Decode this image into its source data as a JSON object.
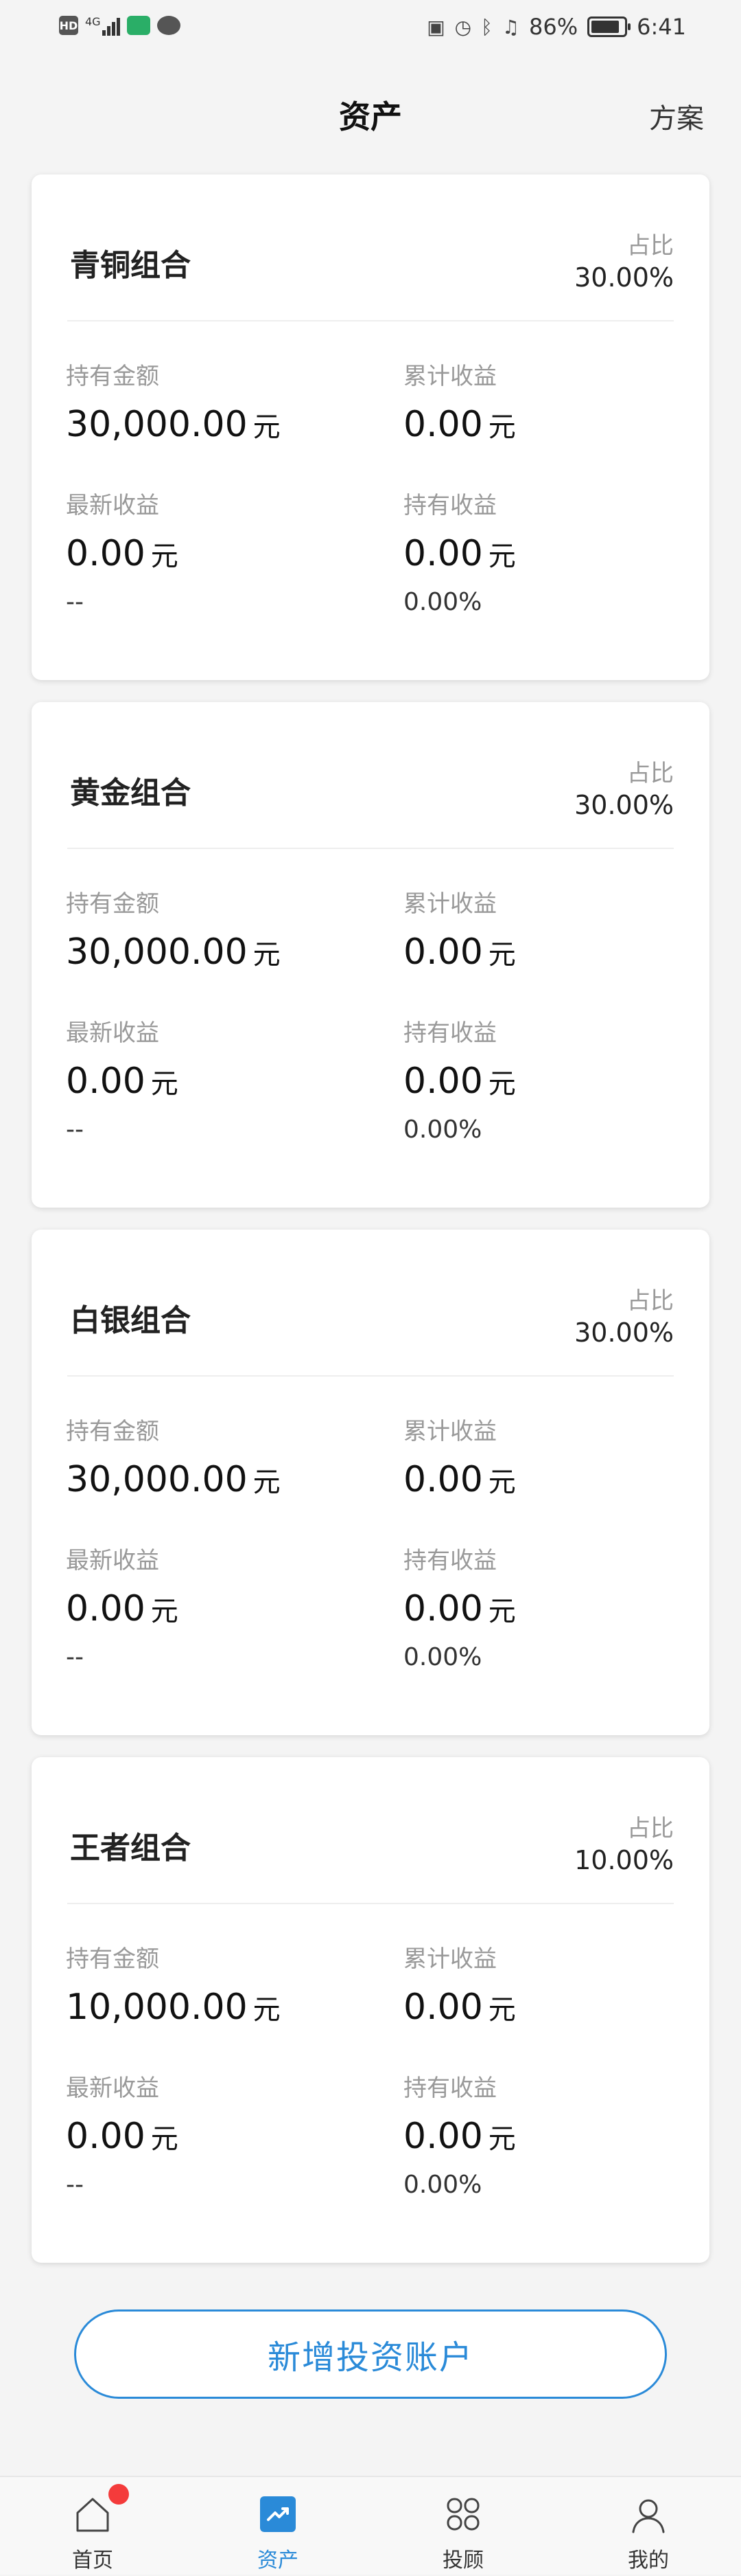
{
  "status_bar": {
    "network": "4G",
    "battery": "86%",
    "battery_level": 0.86,
    "time": "6:41"
  },
  "header": {
    "title": "资产",
    "plan_label": "方案"
  },
  "labels": {
    "ratio": "占比",
    "holding_amount": "持有金额",
    "cumulative_income": "累计收益",
    "latest_income": "最新收益",
    "holding_income": "持有收益",
    "unit": "元"
  },
  "portfolios": [
    {
      "name": "青铜组合",
      "ratio": "30.00%",
      "holding_amount": "30,000.00",
      "cumulative_income": "0.00",
      "latest_income": "0.00",
      "latest_change": "--",
      "holding_income": "0.00",
      "holding_rate": "0.00%"
    },
    {
      "name": "黄金组合",
      "ratio": "30.00%",
      "holding_amount": "30,000.00",
      "cumulative_income": "0.00",
      "latest_income": "0.00",
      "latest_change": "--",
      "holding_income": "0.00",
      "holding_rate": "0.00%"
    },
    {
      "name": "白银组合",
      "ratio": "30.00%",
      "holding_amount": "30,000.00",
      "cumulative_income": "0.00",
      "latest_income": "0.00",
      "latest_change": "--",
      "holding_income": "0.00",
      "holding_rate": "0.00%"
    },
    {
      "name": "王者组合",
      "ratio": "10.00%",
      "holding_amount": "10,000.00",
      "cumulative_income": "0.00",
      "latest_income": "0.00",
      "latest_change": "--",
      "holding_income": "0.00",
      "holding_rate": "0.00%"
    }
  ],
  "add_account_label": "新增投资账户",
  "tab_bar": {
    "items": [
      {
        "label": "首页",
        "icon": "home-icon",
        "badge": true
      },
      {
        "label": "资产",
        "icon": "assets-chart-icon",
        "active": true
      },
      {
        "label": "投顾",
        "icon": "advisor-grid-icon"
      },
      {
        "label": "我的",
        "icon": "profile-icon"
      }
    ]
  },
  "colors": {
    "accent": "#2a8ad8",
    "badge": "#f43b3b",
    "wechat": "#2aae67"
  }
}
